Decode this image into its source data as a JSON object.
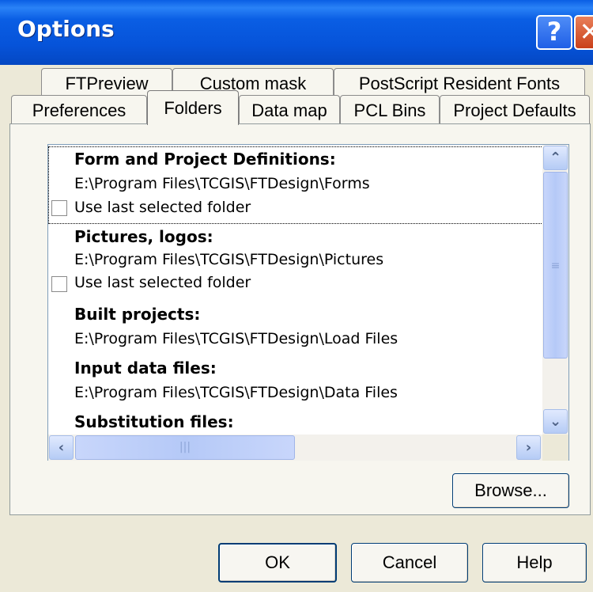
{
  "window": {
    "title": "Options",
    "help_glyph": "?",
    "close_glyph": "✕"
  },
  "tabs": {
    "row_back": [
      {
        "label": "FTPreview"
      },
      {
        "label": "Custom mask"
      },
      {
        "label": "PostScript Resident Fonts"
      }
    ],
    "row_front": [
      {
        "label": "Preferences"
      },
      {
        "label": "Folders",
        "active": true
      },
      {
        "label": "Data map"
      },
      {
        "label": "PCL Bins"
      },
      {
        "label": "Project Defaults"
      }
    ]
  },
  "folders_list": {
    "items": [
      {
        "title": "Form and Project Definitions:",
        "path": "E:\\Program Files\\TCGIS\\FTDesign\\Forms",
        "checkbox_label": "Use last selected folder",
        "checked": false
      },
      {
        "title": "Pictures, logos:",
        "path": "E:\\Program Files\\TCGIS\\FTDesign\\Pictures",
        "checkbox_label": "Use last selected folder",
        "checked": false
      },
      {
        "title": "Built projects:",
        "path": "E:\\Program Files\\TCGIS\\FTDesign\\Load Files"
      },
      {
        "title": "Input data files:",
        "path": "E:\\Program Files\\TCGIS\\FTDesign\\Data Files"
      },
      {
        "title": "Substitution files:"
      }
    ],
    "scroll_glyphs": {
      "up": "⌃",
      "down": "⌄",
      "left": "‹",
      "right": "›",
      "grip_v": "≡",
      "grip_h": "|||"
    }
  },
  "buttons": {
    "browse": "Browse...",
    "ok": "OK",
    "cancel": "Cancel",
    "help": "Help"
  },
  "colors": {
    "titlebar": "#0a5ee4",
    "dialog_bg": "#ece9d8",
    "panel_bg": "#f7f6ef",
    "close_button": "#d9542c"
  }
}
